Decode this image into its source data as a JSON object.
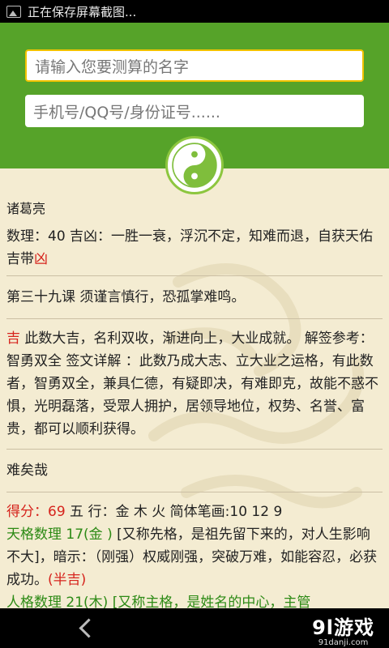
{
  "status_bar": {
    "text": "正在保存屏幕截图..."
  },
  "header": {
    "name_placeholder": "请输入您要测算的名字",
    "id_placeholder": "手机号/QQ号/身份证号......"
  },
  "result": {
    "name": "诸葛亮",
    "shuli_text": "数理：40  吉凶：一胜一衰，浮沉不定，知难而退，自获天佑 吉带",
    "shuli_bad": "凶",
    "lesson": "第三十九课 须谨言慎行，恐孤掌难鸣。",
    "verdict": "吉",
    "verdict_text": " 此数大吉，名利双收，渐进向上，大业成就。 解签参考：智勇双全 签文详解 ：此数乃成大志、立大业之运格，有此数者，智勇双全，兼具仁德，有疑即决，有难即克，故能不惑不惧，光明磊落，受眾人拥护，居领导地位，权势、名誉、富贵，都可以顺利获得。",
    "exclaim": "难矣哉",
    "score_label": "得分：69",
    "wuxing_text": " 五 行：金 木 火   简体笔画:10 12 9",
    "tiange_label": "天格数理 17(金 )",
    "tiange_text": " [又称先格，是祖先留下来的，对人生影响不大]，暗示：（刚强）权威刚强，突破万难，如能容忍，必获成功。",
    "tiange_result": "(半吉)",
    "cut_line": "人格数理 21(木) [又称主格，是姓名的中心，主管"
  },
  "nav_bar": {
    "brand_big": "9l游戏",
    "brand_small": "91danji.com"
  },
  "colors": {
    "header_green": "#56a329",
    "background": "#f4ecd2",
    "red": "#d6241d",
    "green": "#2c8a15"
  }
}
